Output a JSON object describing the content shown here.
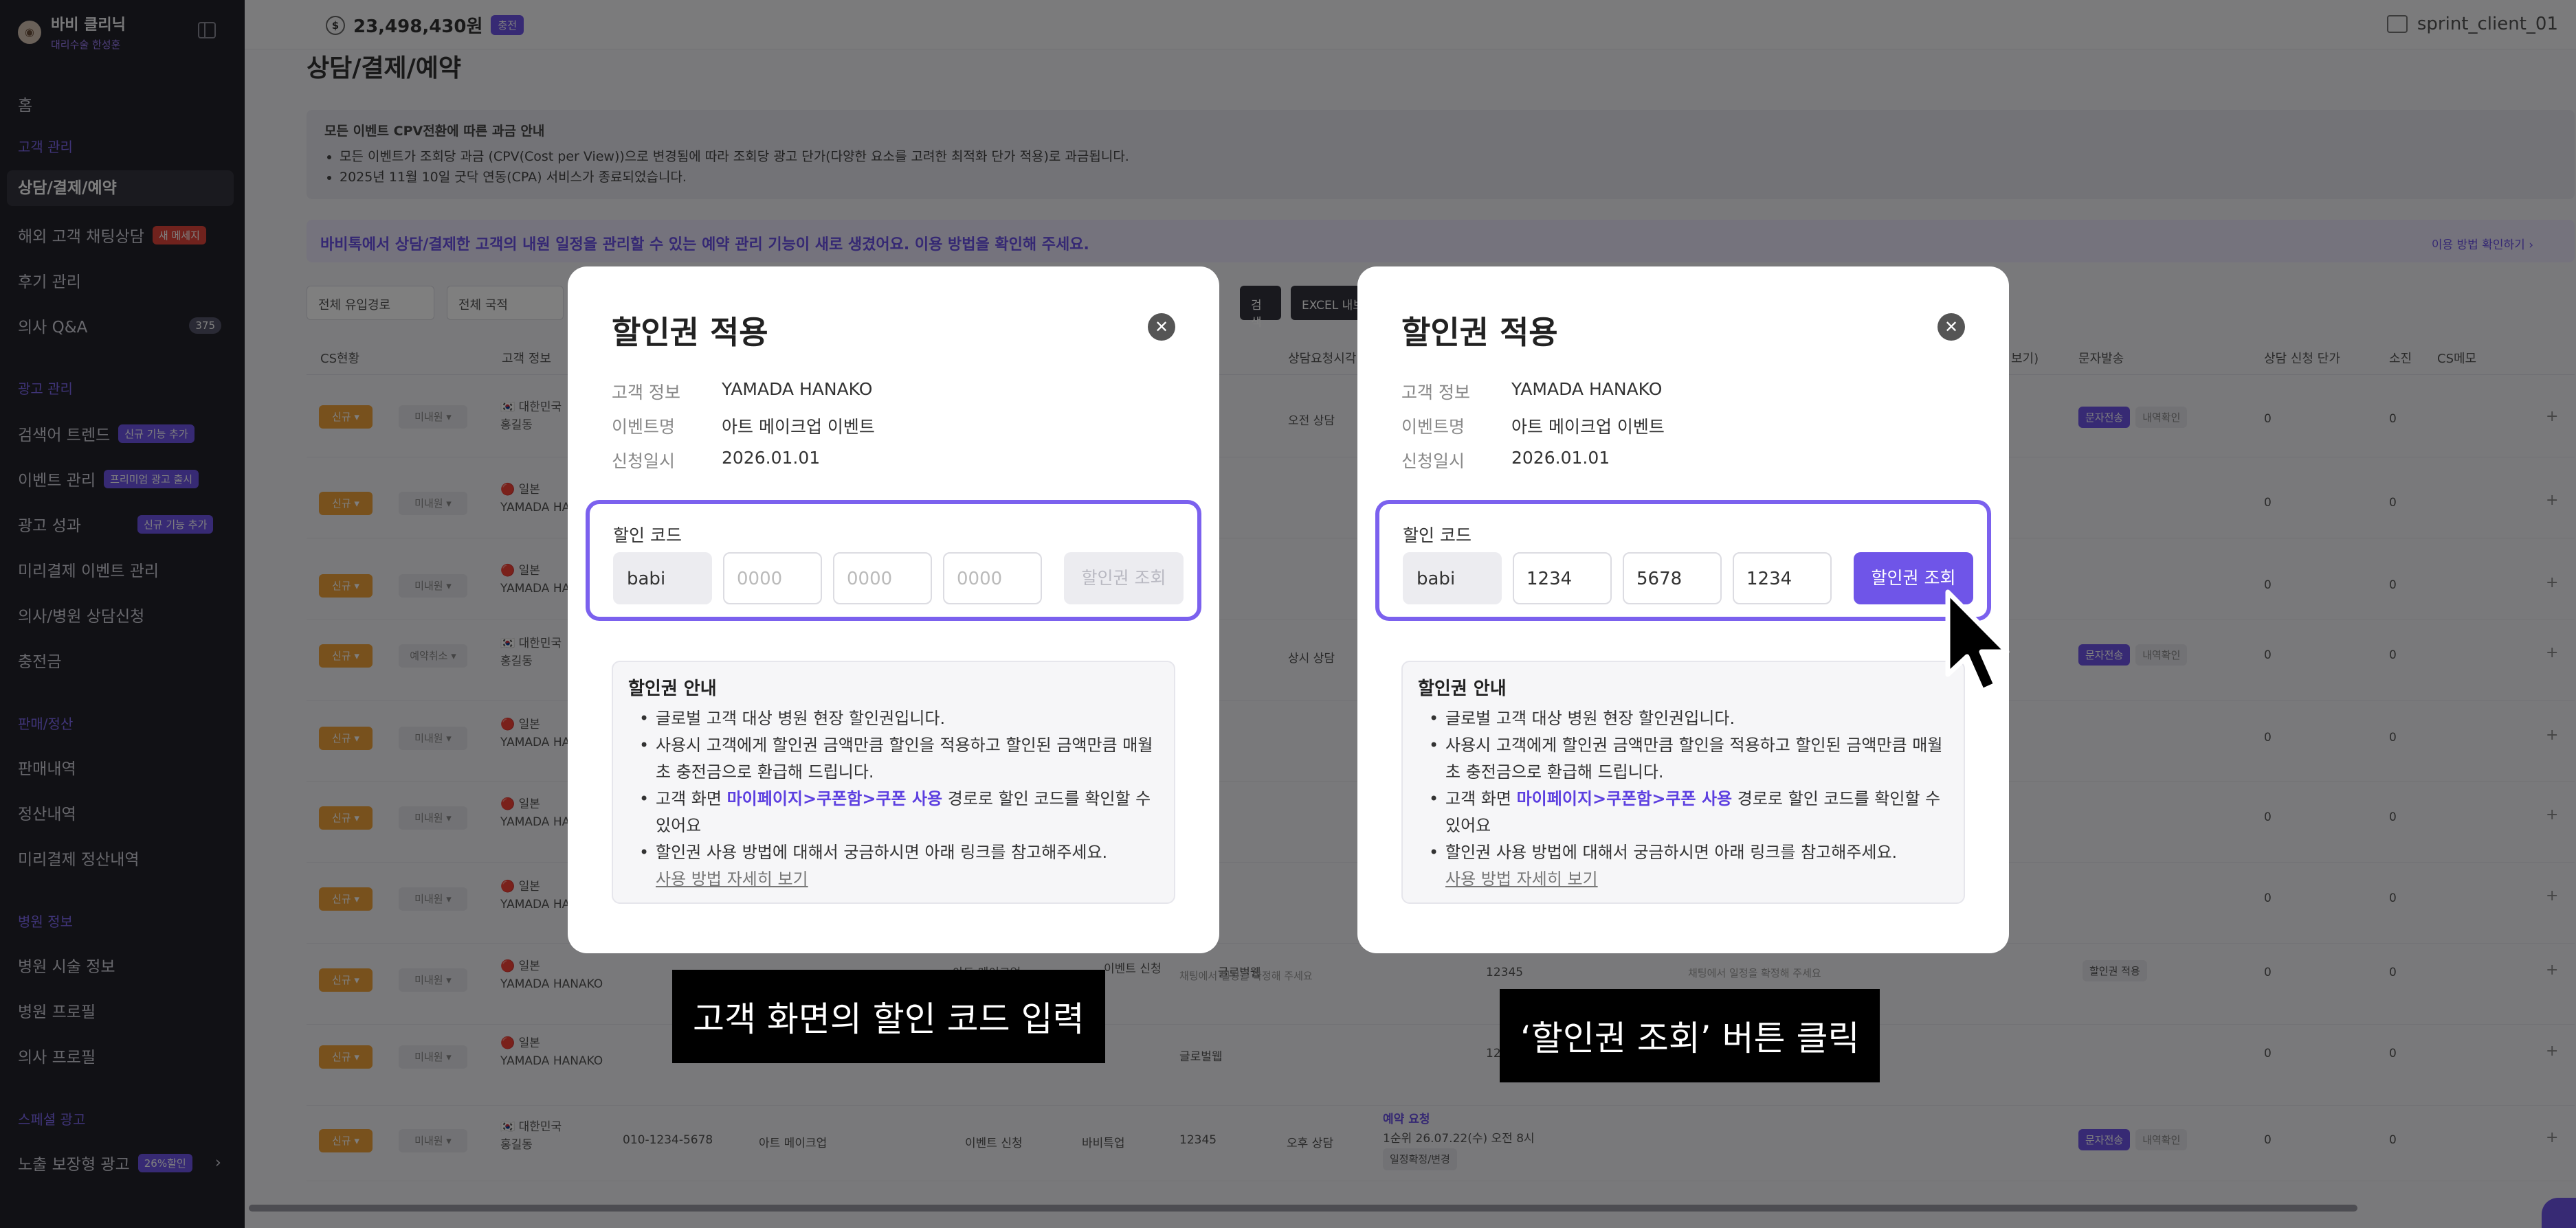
{
  "sidebar": {
    "brand_name": "바비 클리닉",
    "brand_sub": "대리수술 한성훈",
    "home": "홈",
    "sections": {
      "customer": "고객 관리",
      "ads": "광고 관리",
      "sales": "판매/정산",
      "hospital": "병원 정보",
      "special": "스페셜 광고"
    },
    "items": {
      "consult": "상담/결제/예약",
      "overseas_chat": "해외 고객 채팅상담",
      "overseas_badge": "새 메세지",
      "reviews": "후기 관리",
      "doctor_qa": "의사 Q&A",
      "doctor_qa_count": "375",
      "search_trend": "검색어 트렌드",
      "search_trend_badge": "신규 기능 추가",
      "event_mgmt": "이벤트 관리",
      "event_mgmt_badge": "프리미엄 광고 출시",
      "ad_perf": "광고 성과",
      "ad_perf_badge": "신규 기능 추가",
      "prepaid_event": "미리결제 이벤트 관리",
      "doctor_consult": "의사/병원 상담신청",
      "recharge": "충전금",
      "sales_history": "판매내역",
      "settlement": "정산내역",
      "prepaid_settlement": "미리결제 정산내역",
      "hospital_info": "병원 시술 정보",
      "hospital_profile": "병원 프로필",
      "doctor_profile": "의사 프로필",
      "exposure_ad": "노출 보장형 광고",
      "exposure_badge": "26%할인"
    }
  },
  "topbar": {
    "balance": "23,498,430원",
    "charge": "충전",
    "client": "sprint_client_01"
  },
  "main": {
    "title": "상담/결제/예약",
    "notice_title": "모든 이벤트 CPV전환에 따른 과금 안내",
    "notice_lines": [
      "모든 이벤트가 조회당 과금 (CPV(Cost per View))으로 변경됨에 따라 조회당 광고 단가(다양한 요소를 고려한 최적화 단가 적용)로 과금됩니다.",
      "2025년 11월 10일 굿닥 연동(CPA) 서비스가 종료되었습니다."
    ],
    "banner": "바비톡에서 상담/결제한 고객의 내원 일정을 관리할 수 있는 예약 관리 기능이 새로 생겼어요. 이용 방법을 확인해 주세요.",
    "banner_link": "이용 방법 확인하기 ›",
    "filters": [
      "전체 유입경로",
      "전체 국적"
    ],
    "search_btn": "검색",
    "excel_btn": "EXCEL 내보",
    "headers": {
      "cs": "CS현황",
      "customer": "고객 정보",
      "consult_time": "상담요청시각",
      "view": "보기)",
      "sms": "문자발송",
      "unit_price": "상담 신청 단가",
      "burn": "소진",
      "memo": "CS메모"
    },
    "row_new": "신규 ▾",
    "row_unpaid": "미내원 ▾",
    "row_cancel": "예약취소 ▾",
    "rows": [
      {
        "flag": "🇰🇷 대한민국",
        "name": "홍길동",
        "time": "오전 상담"
      },
      {
        "flag": "🔴 일본",
        "name": "YAMADA HANAKO"
      },
      {
        "flag": "🔴 일본",
        "name": "YAMADA HANAKO"
      },
      {
        "flag": "🇰🇷 대한민국",
        "name": "홍길동",
        "time": "상시 상담"
      },
      {
        "flag": "🔴 일본",
        "name": "YAMADA HANAKO"
      },
      {
        "flag": "🔴 일본",
        "name": "YAMADA HANAKO"
      },
      {
        "flag": "🔴 일본",
        "name": "YAMADA HANAKO"
      },
      {
        "flag": "🔴 일본",
        "name": "YAMADA HANAKO"
      },
      {
        "flag": "🔴 일본",
        "name": "YAMADA HANAKO"
      },
      {
        "flag": "🇰🇷 대한민국",
        "name": "홍길동"
      }
    ],
    "row_extra": {
      "event_name": "아트 메이크업",
      "event_apply": "이벤트 신청",
      "channel1": "글로벌웹",
      "channel2": "바비특업",
      "code": "12345",
      "phone": "010-1234-5678",
      "apply_btn": "할인권 적용",
      "schedule_note": "채팅에서 일정을 확정해 주세요",
      "reserve_req": "예약 요청",
      "reserve_detail": "1순위 26.07.22(수) 오전 8시",
      "schedule_btn": "일정확정/변경",
      "late_time": "오후 상담"
    },
    "sms_send": "문자전송",
    "sms_history": "내역확인",
    "zero": "0",
    "plus": "+"
  },
  "modal_left": {
    "title": "할인권 적용",
    "close": "✕",
    "customer_label": "고객 정보",
    "customer_value": "YAMADA HANAKO",
    "event_label": "이벤트명",
    "event_value": "아트 메이크업 이벤트",
    "date_label": "신청일시",
    "date_value": "2026.01.01",
    "code_label": "할인 코드",
    "prefix": "babi",
    "placeholder": "0000",
    "lookup": "할인권 조회",
    "guide_title": "할인권 안내",
    "guide_1": "글로벌 고객 대상 병원 현장 할인권입니다.",
    "guide_2": "사용시 고객에게 할인권 금액만큼 할인을 적용하고 할인된 금액만큼 매월 초 충전금으로 환급해 드립니다.",
    "guide_3_pre": "고객 화면 ",
    "guide_3_hl": "마이페이지>쿠폰함>쿠폰 사용",
    "guide_3_post": " 경로로 할인 코드를 확인할 수 있어요",
    "guide_4": "할인권 사용 방법에 대해서 궁금하시면 아래 링크를 참고해주세요.",
    "guide_link": "사용 방법 자세히 보기"
  },
  "modal_right": {
    "title": "할인권 적용",
    "close": "✕",
    "customer_label": "고객 정보",
    "customer_value": "YAMADA HANAKO",
    "event_label": "이벤트명",
    "event_value": "아트 메이크업 이벤트",
    "date_label": "신청일시",
    "date_value": "2026.01.01",
    "code_label": "할인 코드",
    "prefix": "babi",
    "code_1": "1234",
    "code_2": "5678",
    "code_3": "1234",
    "lookup": "할인권 조회",
    "guide_title": "할인권 안내",
    "guide_1": "글로벌 고객 대상 병원 현장 할인권입니다.",
    "guide_2": "사용시 고객에게 할인권 금액만큼 할인을 적용하고 할인된 금액만큼 매월 초 충전금으로 환급해 드립니다.",
    "guide_3_pre": "고객 화면 ",
    "guide_3_hl": "마이페이지>쿠폰함>쿠폰 사용",
    "guide_3_post": " 경로로 할인 코드를 확인할 수 있어요",
    "guide_4": "할인권 사용 방법에 대해서 궁금하시면 아래 링크를 참고해주세요.",
    "guide_link": "사용 방법 자세히 보기"
  },
  "captions": {
    "left": "고객 화면의 할인 코드 입력",
    "right": "‘할인권 조회’ 버튼 클릭"
  },
  "colors": {
    "accent": "#6f55e8",
    "sidebar_bg": "#22222a",
    "highlight_border": "#7b61ee"
  }
}
